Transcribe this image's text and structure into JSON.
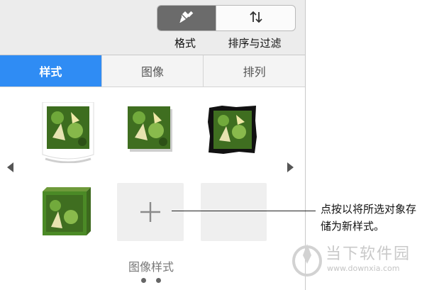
{
  "toolbar": {
    "format_label": "格式",
    "sort_filter_label": "排序与过滤",
    "format_icon": "paintbrush-icon",
    "sort_icon": "sort-arrows-icon"
  },
  "tabs": [
    {
      "label": "样式",
      "active": true
    },
    {
      "label": "图像",
      "active": false
    },
    {
      "label": "排列",
      "active": false
    }
  ],
  "styles": {
    "section_label": "图像样式",
    "page_dots": 2,
    "items": [
      {
        "name": "curled-paper-frame"
      },
      {
        "name": "drop-shadow"
      },
      {
        "name": "rough-black-border"
      },
      {
        "name": "3d-green-block"
      }
    ],
    "add_icon": "plus-icon"
  },
  "callout": {
    "text": "点按以将所选对象存储为新样式。"
  },
  "watermark": {
    "title": "当下软件园",
    "url": "www.downxia.com"
  },
  "colors": {
    "accent": "#2f8cf4",
    "active_segment": "#6b6b6b"
  }
}
